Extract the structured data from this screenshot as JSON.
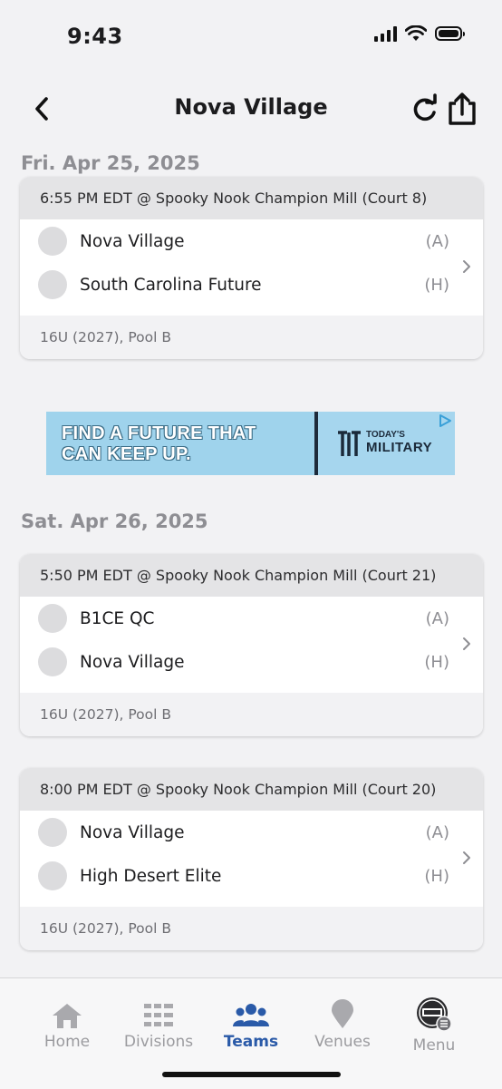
{
  "status_bar": {
    "time": "9:43"
  },
  "nav": {
    "title": "Nova Village"
  },
  "days": [
    {
      "date": "Fri. Apr 25, 2025",
      "games": [
        {
          "header": "6:55 PM EDT @ Spooky Nook Champion Mill (Court 8)",
          "teams": [
            {
              "name": "Nova Village",
              "side": "(A)"
            },
            {
              "name": "South Carolina Future",
              "side": "(H)"
            }
          ],
          "footer": "16U (2027), Pool B"
        }
      ]
    },
    {
      "date": "Sat. Apr 26, 2025",
      "games": [
        {
          "header": "5:50 PM EDT @ Spooky Nook Champion Mill (Court 21)",
          "teams": [
            {
              "name": "B1CE QC",
              "side": "(A)"
            },
            {
              "name": "Nova Village",
              "side": "(H)"
            }
          ],
          "footer": "16U (2027), Pool B"
        },
        {
          "header": "8:00 PM EDT @ Spooky Nook Champion Mill (Court 20)",
          "teams": [
            {
              "name": "Nova Village",
              "side": "(A)"
            },
            {
              "name": "High Desert Elite",
              "side": "(H)"
            }
          ],
          "footer": "16U (2027), Pool B"
        }
      ]
    }
  ],
  "ad": {
    "tagline_line1": "FIND A FUTURE THAT",
    "tagline_line2": "CAN KEEP UP.",
    "brand_top": "TODAY'S",
    "brand_main": "MILITARY"
  },
  "tab_bar": {
    "tabs": [
      {
        "label": "Home",
        "icon": "home-icon"
      },
      {
        "label": "Divisions",
        "icon": "divisions-icon"
      },
      {
        "label": "Teams",
        "icon": "teams-icon",
        "active": true
      },
      {
        "label": "Venues",
        "icon": "venue-pin-icon"
      },
      {
        "label": "Menu",
        "icon": "menu-logo-icon"
      }
    ]
  },
  "colors": {
    "background": "#f2f2f4",
    "card_header": "#e4e4e6",
    "active_tab": "#2a5aa8",
    "inactive_tab": "#9b9b9f",
    "date_header": "#8e8e93"
  }
}
